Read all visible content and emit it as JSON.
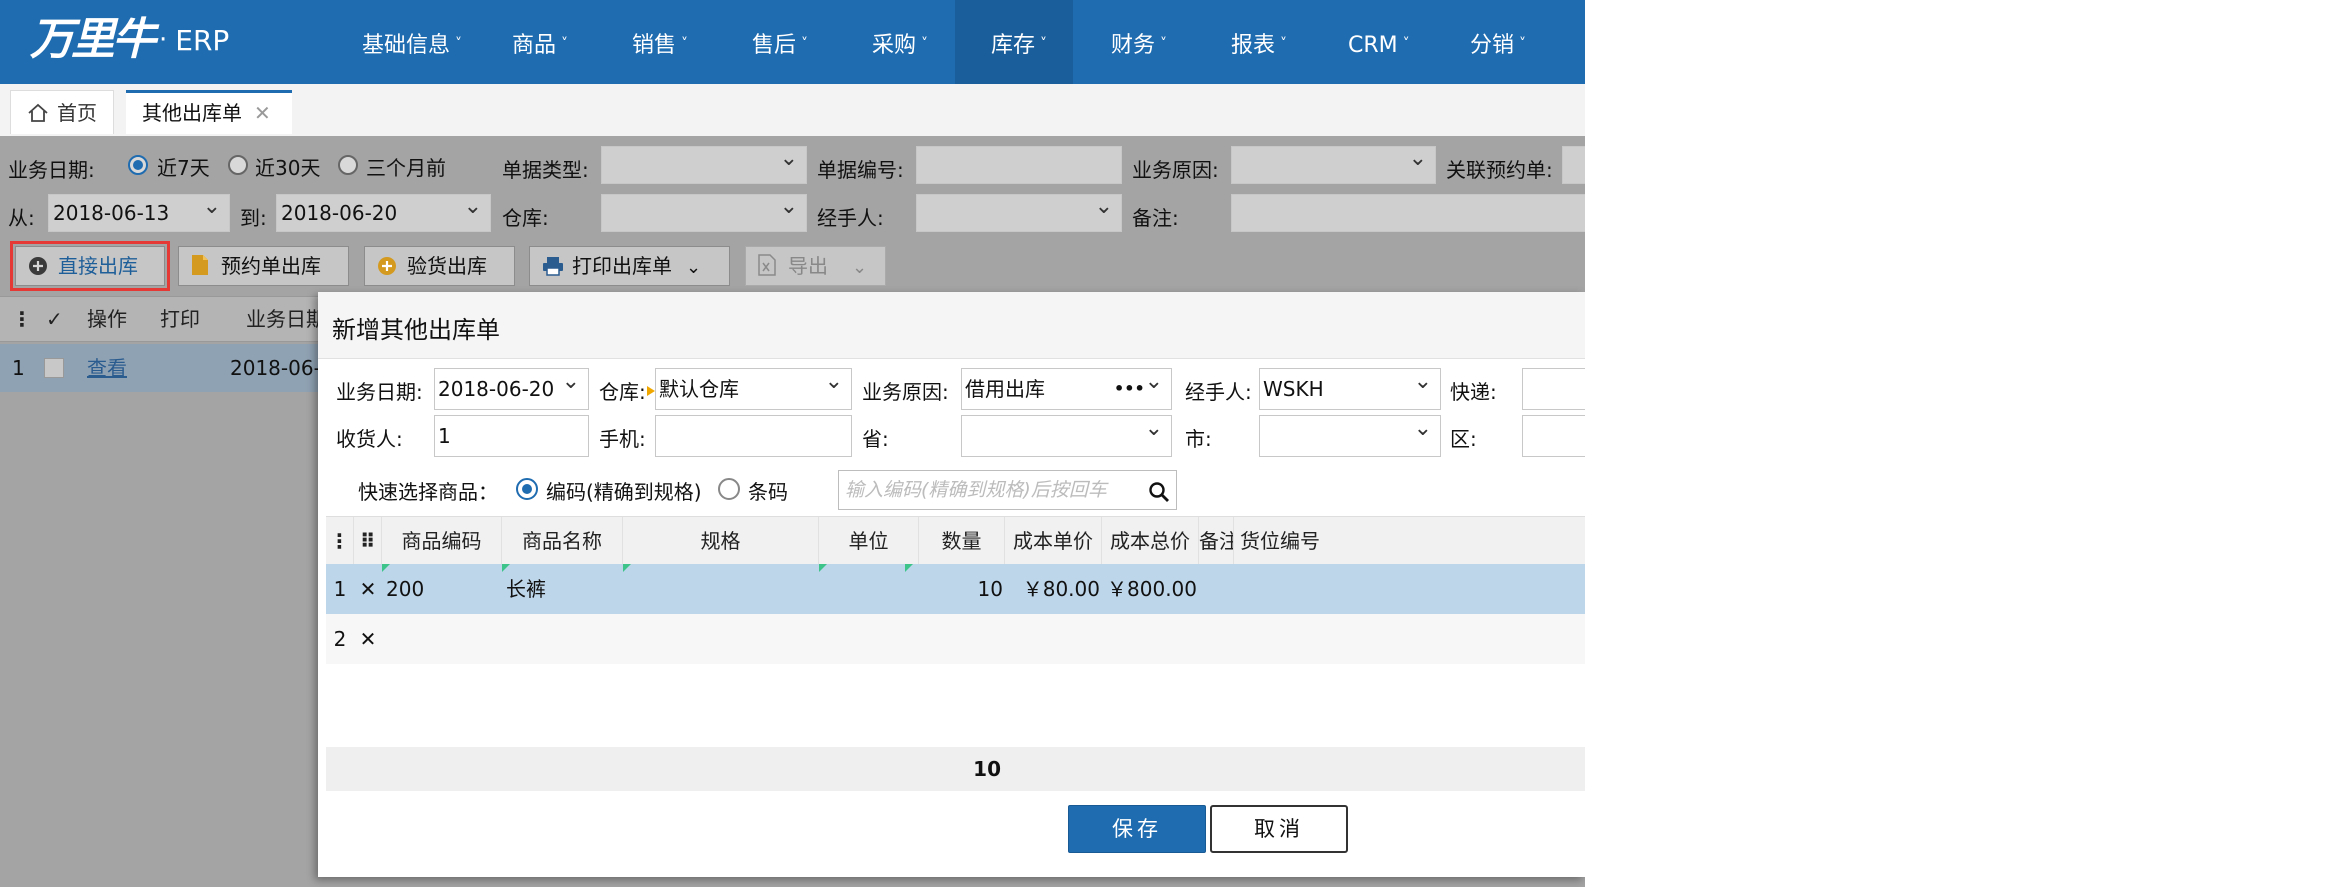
{
  "app": {
    "logo_mark": "万里牛",
    "logo_dot": "·",
    "logo_text": "ERP"
  },
  "nav": [
    {
      "label": "基础信息",
      "active": false
    },
    {
      "label": "商品",
      "active": false
    },
    {
      "label": "销售",
      "active": false
    },
    {
      "label": "售后",
      "active": false
    },
    {
      "label": "采购",
      "active": false
    },
    {
      "label": "库存",
      "active": true
    },
    {
      "label": "财务",
      "active": false
    },
    {
      "label": "报表",
      "active": false
    },
    {
      "label": "CRM",
      "active": false
    },
    {
      "label": "分销",
      "active": false
    }
  ],
  "nav_caret": "˅",
  "tabs": {
    "home": "首页",
    "active": "其他出库单",
    "close": "✕"
  },
  "filters": {
    "biz_date_label": "业务日期:",
    "radio_7": "近7天",
    "radio_30": "近30天",
    "radio_3m": "三个月前",
    "doc_type_label": "单据类型:",
    "doc_no_label": "单据编号:",
    "reason_label": "业务原因:",
    "related_label": "关联预约单:",
    "from_label": "从:",
    "from_value": "2018-06-13",
    "to_label": "到:",
    "to_value": "2018-06-20",
    "warehouse_label": "仓库:",
    "handler_label": "经手人:",
    "note_label": "备注:"
  },
  "toolbar": {
    "direct_out": "直接出库",
    "reserve_out": "预约单出库",
    "inspect_out": "验货出库",
    "print_out": "打印出库单",
    "export": "导出"
  },
  "list": {
    "headers": {
      "menu": "⋮",
      "check": "✓",
      "op": "操作",
      "print": "打印",
      "biz_date": "业务日期"
    },
    "row": {
      "no": "1",
      "view": "查看",
      "date": "2018-06-"
    }
  },
  "modal": {
    "title": "新增其他出库单",
    "biz_date_label": "业务日期:",
    "biz_date_value": "2018-06-20",
    "warehouse_label": "仓库:",
    "warehouse_value": "默认仓库",
    "reason_label": "业务原因:",
    "reason_value": "借用出库",
    "reason_more": "•••",
    "handler_label": "经手人:",
    "handler_value": "WSKH",
    "express_label": "快递:",
    "receiver_label": "收货人:",
    "receiver_value": "1",
    "phone_label": "手机:",
    "province_label": "省:",
    "city_label": "市:",
    "district_label": "区:",
    "quick_select_label": "快速选择商品：",
    "radio_code": "编码(精确到规格)",
    "radio_barcode": "条码",
    "search_placeholder": "输入编码(精确到规格)后按回车",
    "grid_headers": {
      "menu": "⋮",
      "drag": "⠿",
      "code": "商品编码",
      "name": "商品名称",
      "spec": "规格",
      "unit": "单位",
      "qty": "数量",
      "unit_cost": "成本单价",
      "total_cost": "成本总价",
      "remark": "备注",
      "location": "货位编号"
    },
    "rows": [
      {
        "no": "1",
        "del": "✕",
        "code": "200",
        "name": "长裤",
        "spec": "",
        "unit": "",
        "qty": "10",
        "unit_cost": "￥80.00",
        "total_cost": "￥800.00"
      },
      {
        "no": "2",
        "del": "✕",
        "code": "",
        "name": "",
        "spec": "",
        "unit": "",
        "qty": "",
        "unit_cost": "",
        "total_cost": ""
      }
    ],
    "footer_qty": "10",
    "save": "保存",
    "cancel": "取消"
  },
  "colors": {
    "brand": "#1f6cb0",
    "highlight": "#e53935",
    "row_selected": "#bed6ea"
  }
}
